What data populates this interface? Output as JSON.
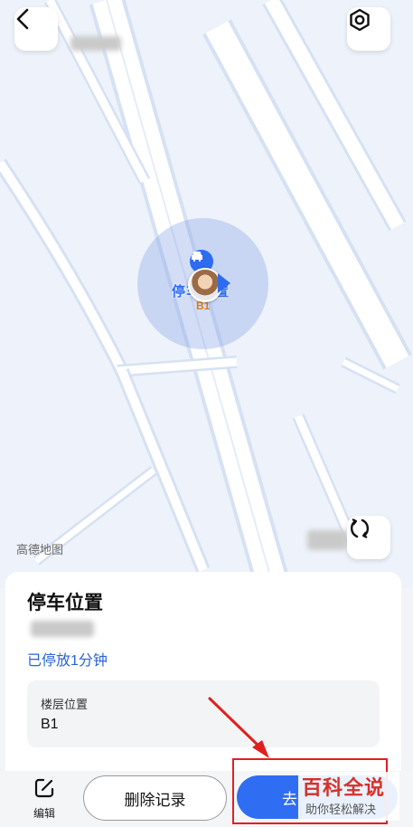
{
  "map": {
    "watermark": "高德地图",
    "marker_label": "停车位置",
    "marker_floor": "B1"
  },
  "icons": {
    "back": "chevron-left-icon",
    "settings": "settings-gear-icon",
    "refresh": "refresh-icon",
    "car": "car-icon",
    "edit": "edit-icon"
  },
  "sheet": {
    "title": "停车位置",
    "parked_duration": "已停放1分钟",
    "floor_label": "楼层位置",
    "floor_value": "B1"
  },
  "bottom_bar": {
    "edit_label": "编辑",
    "delete_label": "删除记录",
    "go_label": "去"
  },
  "overlay": {
    "badge_main": "百科全说",
    "badge_sub": "助你轻松解决"
  },
  "colors": {
    "accent": "#2f6df3",
    "link": "#2a62d8",
    "annotation": "#e02020"
  }
}
